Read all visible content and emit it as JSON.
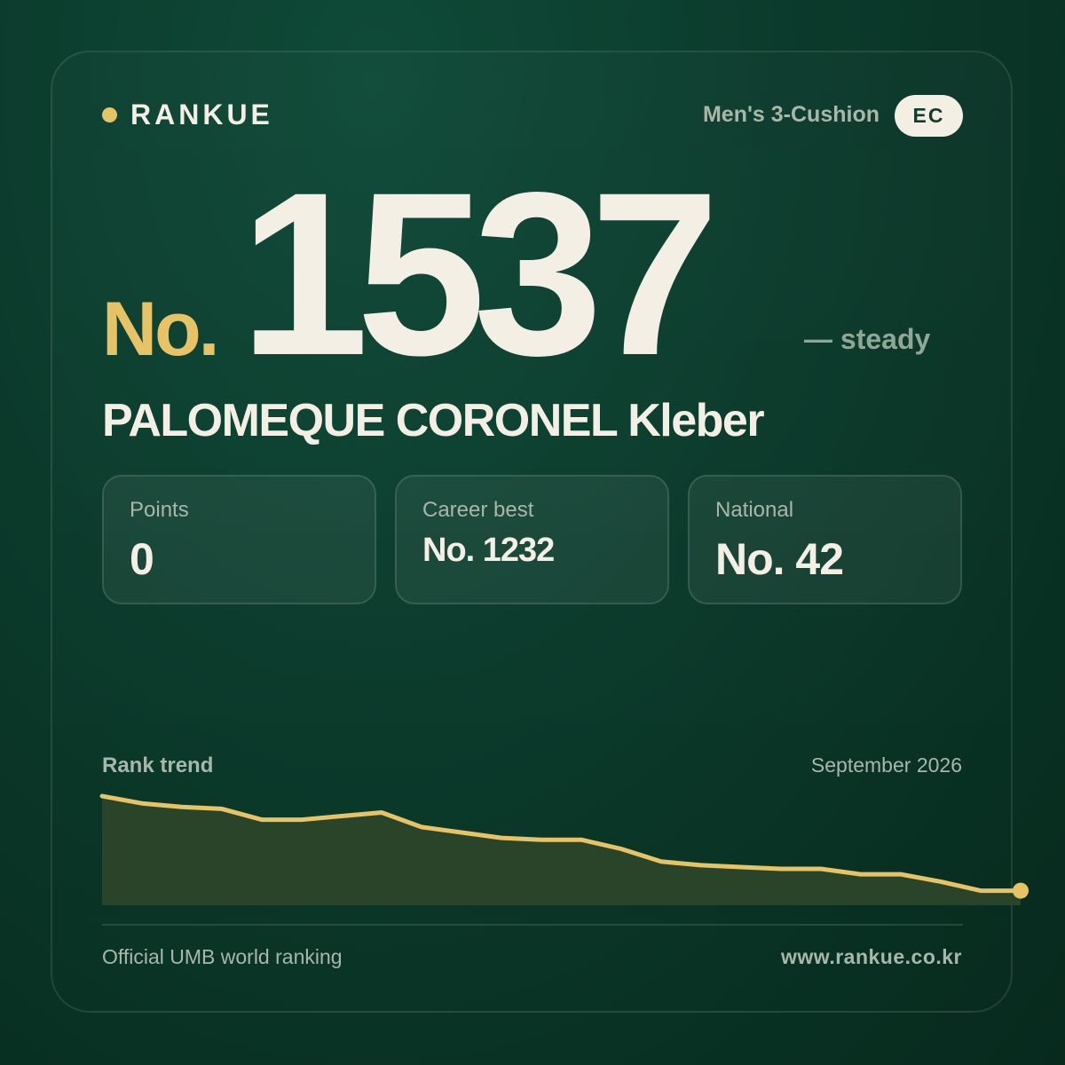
{
  "brand": {
    "name": "RANKUE",
    "dot_color": "#e6c366"
  },
  "category": "Men's 3-Cushion",
  "country_code": "EC",
  "rank": {
    "prefix": "No.",
    "number": "1537",
    "movement": "— steady"
  },
  "player": {
    "name": "PALOMEQUE CORONEL Kleber"
  },
  "stats": [
    {
      "label": "Points",
      "value": "0"
    },
    {
      "label": "Career best",
      "value": "No. 1232"
    },
    {
      "label": "National",
      "value": "No. 42"
    }
  ],
  "trend": {
    "title": "Rank trend",
    "date": "September 2026"
  },
  "chart_data": {
    "type": "area",
    "values": [
      0,
      4,
      6,
      7,
      13,
      13,
      11,
      9,
      17,
      20,
      23,
      24,
      24,
      29,
      36,
      38,
      39,
      40,
      40,
      43,
      43,
      47,
      52,
      52
    ],
    "ylim": [
      0,
      60
    ],
    "line_color": "#e6c366",
    "fill_color": "#2a4429",
    "grid": false
  },
  "footer": {
    "source": "Official UMB world ranking",
    "url": "www.rankue.co.kr"
  },
  "colors": {
    "accent": "#e6c366",
    "text": "#f4efe4",
    "muted": "#a7b8ab",
    "background": "#0b3a2b"
  }
}
